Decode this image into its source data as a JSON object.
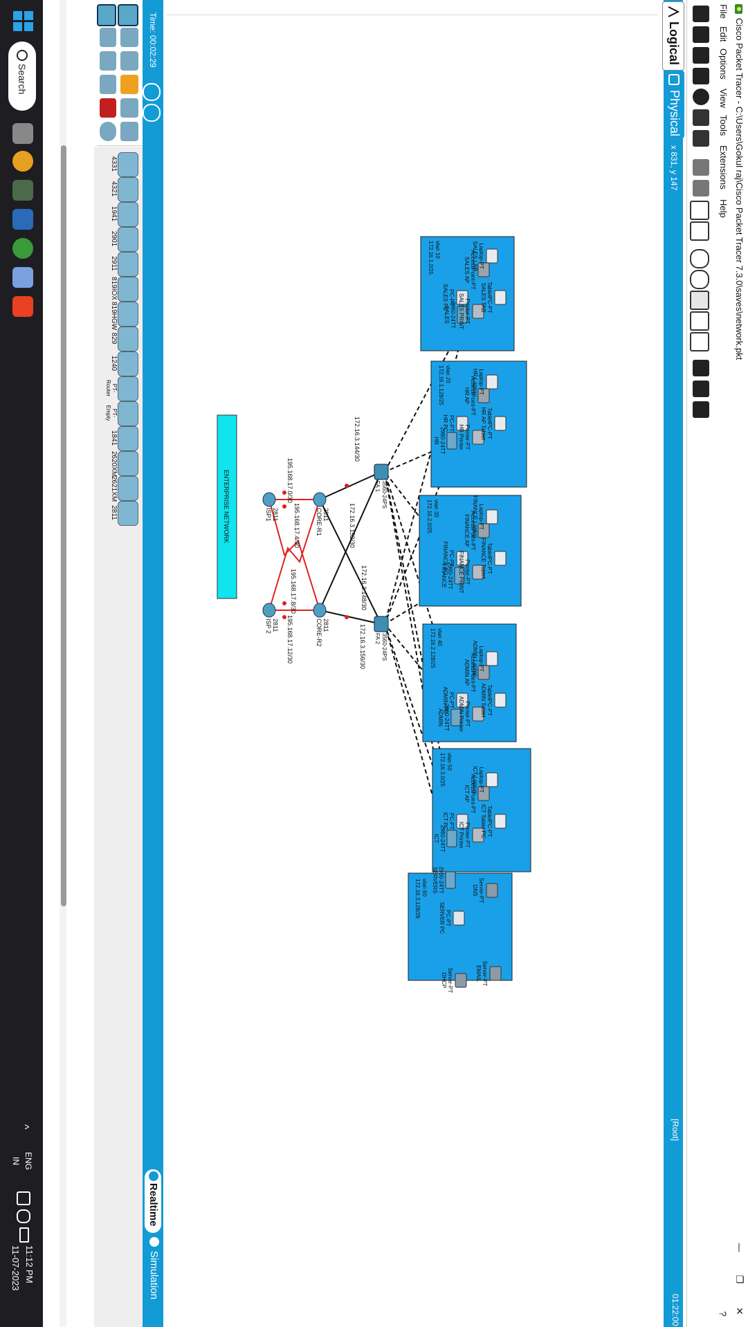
{
  "window": {
    "title": "Cisco Packet Tracer - C:\\Users\\Gokul raj\\Cisco Packet Tracer 7.3.0\\saves\\network.pkt",
    "minimize": "—",
    "restore": "❐",
    "close": "✕",
    "help": "?"
  },
  "menu": [
    "File",
    "Edit",
    "Options",
    "View",
    "Tools",
    "Extensions",
    "Help"
  ],
  "tabs": {
    "logical": "Logical",
    "physical": "Physical"
  },
  "coords": "x 831, y 147",
  "root": "[Root]",
  "clock": "01:22:00",
  "bottom": {
    "time": "Time: 00:02:29",
    "realtime": "Realtime",
    "simulation": "Simulation",
    "selected_model": "2811"
  },
  "device_models": [
    "4331",
    "4321",
    "1941",
    "2901",
    "2911",
    "819IOX",
    "819HGW",
    "829",
    "1240",
    "PT-Router",
    "PT-Empty",
    "1841",
    "2620XM",
    "2621XM",
    "2811"
  ],
  "network": {
    "enterprise": "ENTERPRISE NETWORK",
    "isp1": {
      "model": "2811",
      "name": "ISP1"
    },
    "isp2": {
      "model": "2811",
      "name": "ISP 2"
    },
    "core1": {
      "model": "2811",
      "name": "CORE-R1"
    },
    "core2": {
      "model": "2811",
      "name": "CORE-R2"
    },
    "fa1": {
      "model": "3560-24PS",
      "name": "FA 1"
    },
    "fa2": {
      "model": "3560-24PS",
      "name": "FA 2"
    },
    "ips": {
      "isp1_core1": "195.168.17.0/30",
      "isp1_core2": "195.168.17.4/30",
      "isp2_core1": "195.168.17.8/30",
      "isp2_core2": "195.168.17.12/30",
      "core1_fa1": "172.16.3.144/30",
      "core1_fa2": "172.16.3.152/30",
      "core2_fa1": "172.16.3.148/30",
      "core2_fa2": "172.16.3.156/30"
    },
    "vlans": [
      {
        "switch": "2960-24TT",
        "switch_name": "SALES",
        "ap": "AccessPoint-PT",
        "ap_name": "SALES AP",
        "pc": "PC-PT",
        "pc_name": "SALES PC",
        "printer": "Printer-PT",
        "printer_name": "SALES PRINT",
        "laptop": "Laptop-PT",
        "laptop_name": "SALES LAP",
        "tablet": "TabletPC-PT",
        "tablet_name": "SALES TAB",
        "vlan": "vlan 10",
        "subnet": "172.16.1.0/25"
      },
      {
        "switch": "2960-24TT",
        "switch_name": "HR",
        "ap": "AccessPoint-PT",
        "ap_name": "HR AP",
        "pc": "PC-PT",
        "pc_name": "HR PC",
        "printer": "Printer-PT",
        "printer_name": "HR Printer",
        "laptop": "Laptop-PT",
        "laptop_name": "HR Laptop",
        "tablet": "TabletPC-PT",
        "tablet_name": "HR AP Tablet",
        "vlan": "vlan 20",
        "subnet": "172.16.1.128/25"
      },
      {
        "switch": "2960-24TT",
        "switch_name": "FINANCE",
        "ap": "AccessPoint-PT",
        "ap_name": "FINANCE AP",
        "pc": "PC-PT",
        "pc_name": "FINANCE PC",
        "printer": "Printer-PT",
        "printer_name": "FINANCE PRINT",
        "laptop": "Laptop-PT",
        "laptop_name": "FINANCE Laptop",
        "tablet": "TabletPC-PT",
        "tablet_name": "FINANCE Tablet",
        "vlan": "vlan 30",
        "subnet": "172.16.2.0/25"
      },
      {
        "switch": "2960-24TT",
        "switch_name": "ADMIN",
        "ap": "AccessPoint-PT",
        "ap_name": "ADMIN AP",
        "pc": "PC-PT",
        "pc_name": "ADMIN PC",
        "printer": "Printer-PT",
        "printer_name": "ADMIN Printer",
        "laptop": "Laptop-PT",
        "laptop_name": "ADMIN Laptop",
        "tablet": "TabletPC-PT",
        "tablet_name": "ADMIN Tablet",
        "vlan": "vlan 40",
        "subnet": "172.16.2.128/25"
      },
      {
        "switch": "2960-24TT",
        "switch_name": "ICT",
        "ap": "AccessPoint-PT",
        "ap_name": "ICT AP",
        "pc": "PC-PT",
        "pc_name": "ICT PC",
        "printer": "Printer-PT",
        "printer_name": "ICT Printer",
        "laptop": "Laptop-PT",
        "laptop_name": "ICT Laptop",
        "tablet": "TabletPC-PT",
        "tablet_name": "ICT Tablet PC",
        "vlan": "vlan 50",
        "subnet": "172.16.3.0/25"
      }
    ],
    "server": {
      "switch": "2960-24TT",
      "switch_name": "SERVERS",
      "pc": "PC-PT",
      "pc_name": "SERVER PC",
      "dns": "Server-PT",
      "dns_name": "DNS",
      "dhcp": "Server-PT",
      "dhcp_name": "DHCP",
      "email": "Server-PT",
      "email_name": "EMAIL",
      "vlan": "vlan 60",
      "subnet": "172.16.3.128/26"
    }
  },
  "taskbar": {
    "search": "Search",
    "time": "11:12 PM",
    "date": "11-07-2023",
    "lang1": "ENG",
    "lang2": "IN",
    "chevron": "^"
  },
  "colors": {
    "accent": "#139bd6",
    "vlan_fill": "#1aa0e8",
    "enterprise_fill": "#10e4ef",
    "serial_link": "#e02020",
    "link_ok": "#3ab53a"
  }
}
